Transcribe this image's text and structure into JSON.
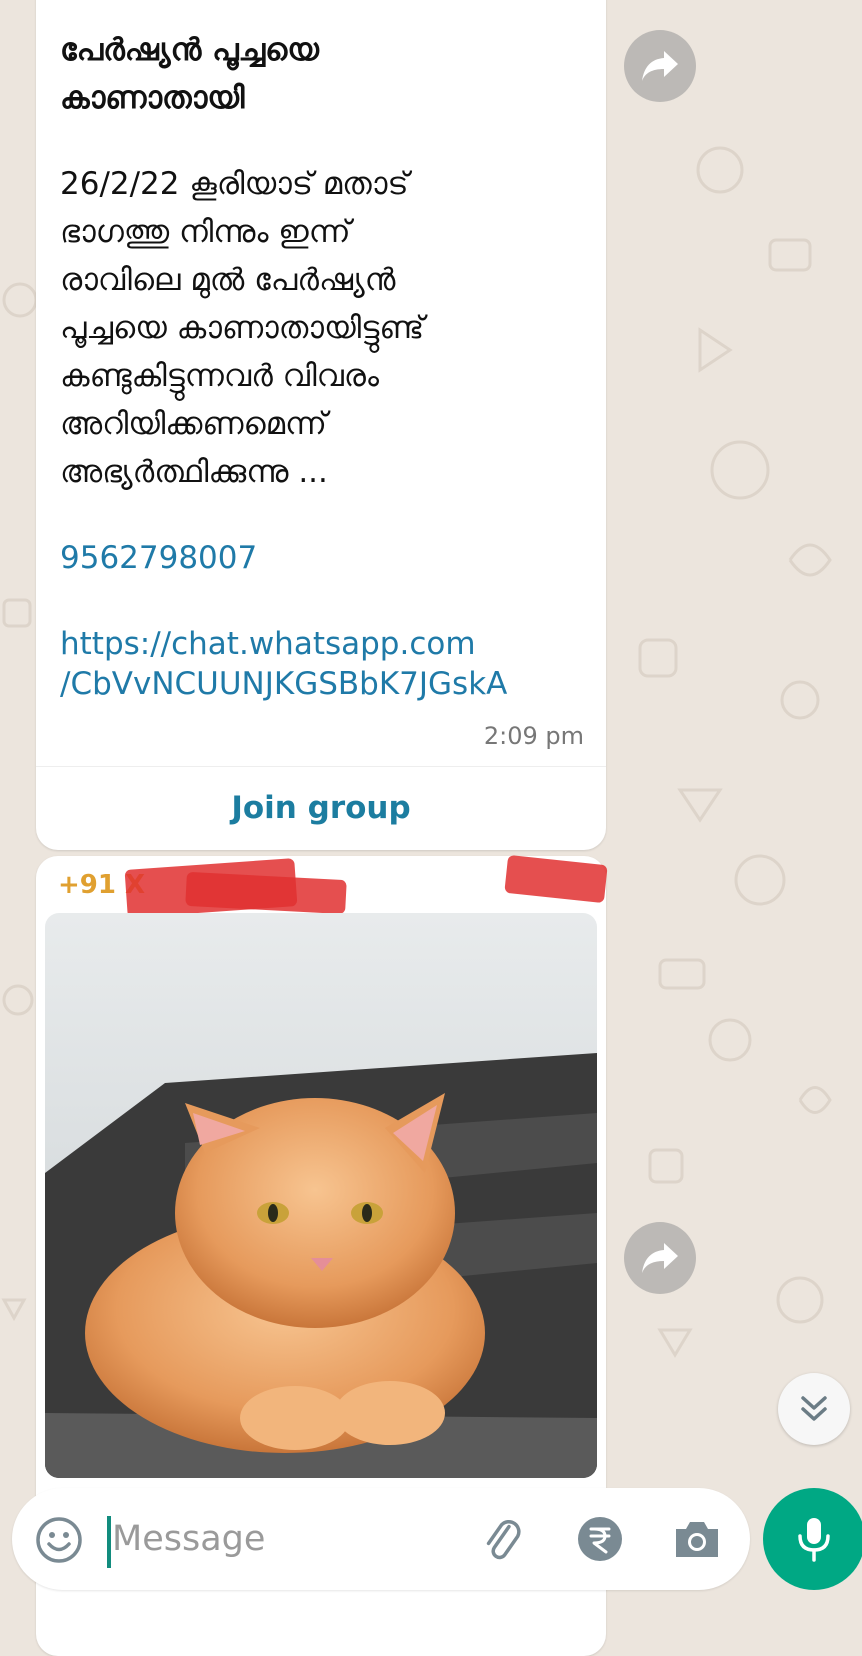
{
  "post": {
    "title": "പേർഷ്യൻ പൂച്ചയെ\nകാണാതായി",
    "body": "26/2/22 കൂരിയാട് മതാട്\nഭാഗത്തു നിന്നും ഇന്ന്\nരാവിലെ മുൽ പേർഷ്യൻ\nപൂച്ചയെ  കാണാതായിട്ടുണ്ട്\nകണ്ടുകിട്ടുന്നവർ വിവരം\nഅറിയിക്കണമെന്ന്\nഅഭ്യർത്ഥിക്കുന്നു ...",
    "phone": "9562798007",
    "link": "https://chat.whatsapp.com\n/CbVvNCUUNJKGSBbK7JGskA",
    "time": "2:09 pm",
    "join_label": "Join group"
  },
  "image_message": {
    "sender": "+91 X"
  },
  "composer": {
    "placeholder": "Message"
  },
  "icons": {
    "forward": "forward-icon",
    "scroll": "double-chevron-down-icon",
    "emoji": "emoji-icon",
    "attach": "paperclip-icon",
    "payment": "rupee-icon",
    "camera": "camera-icon",
    "mic": "mic-icon"
  },
  "colors": {
    "accent": "#00a884",
    "link": "#1f7aa8",
    "chat_background": "#ece5dd",
    "sender_name": "#e0a030"
  }
}
